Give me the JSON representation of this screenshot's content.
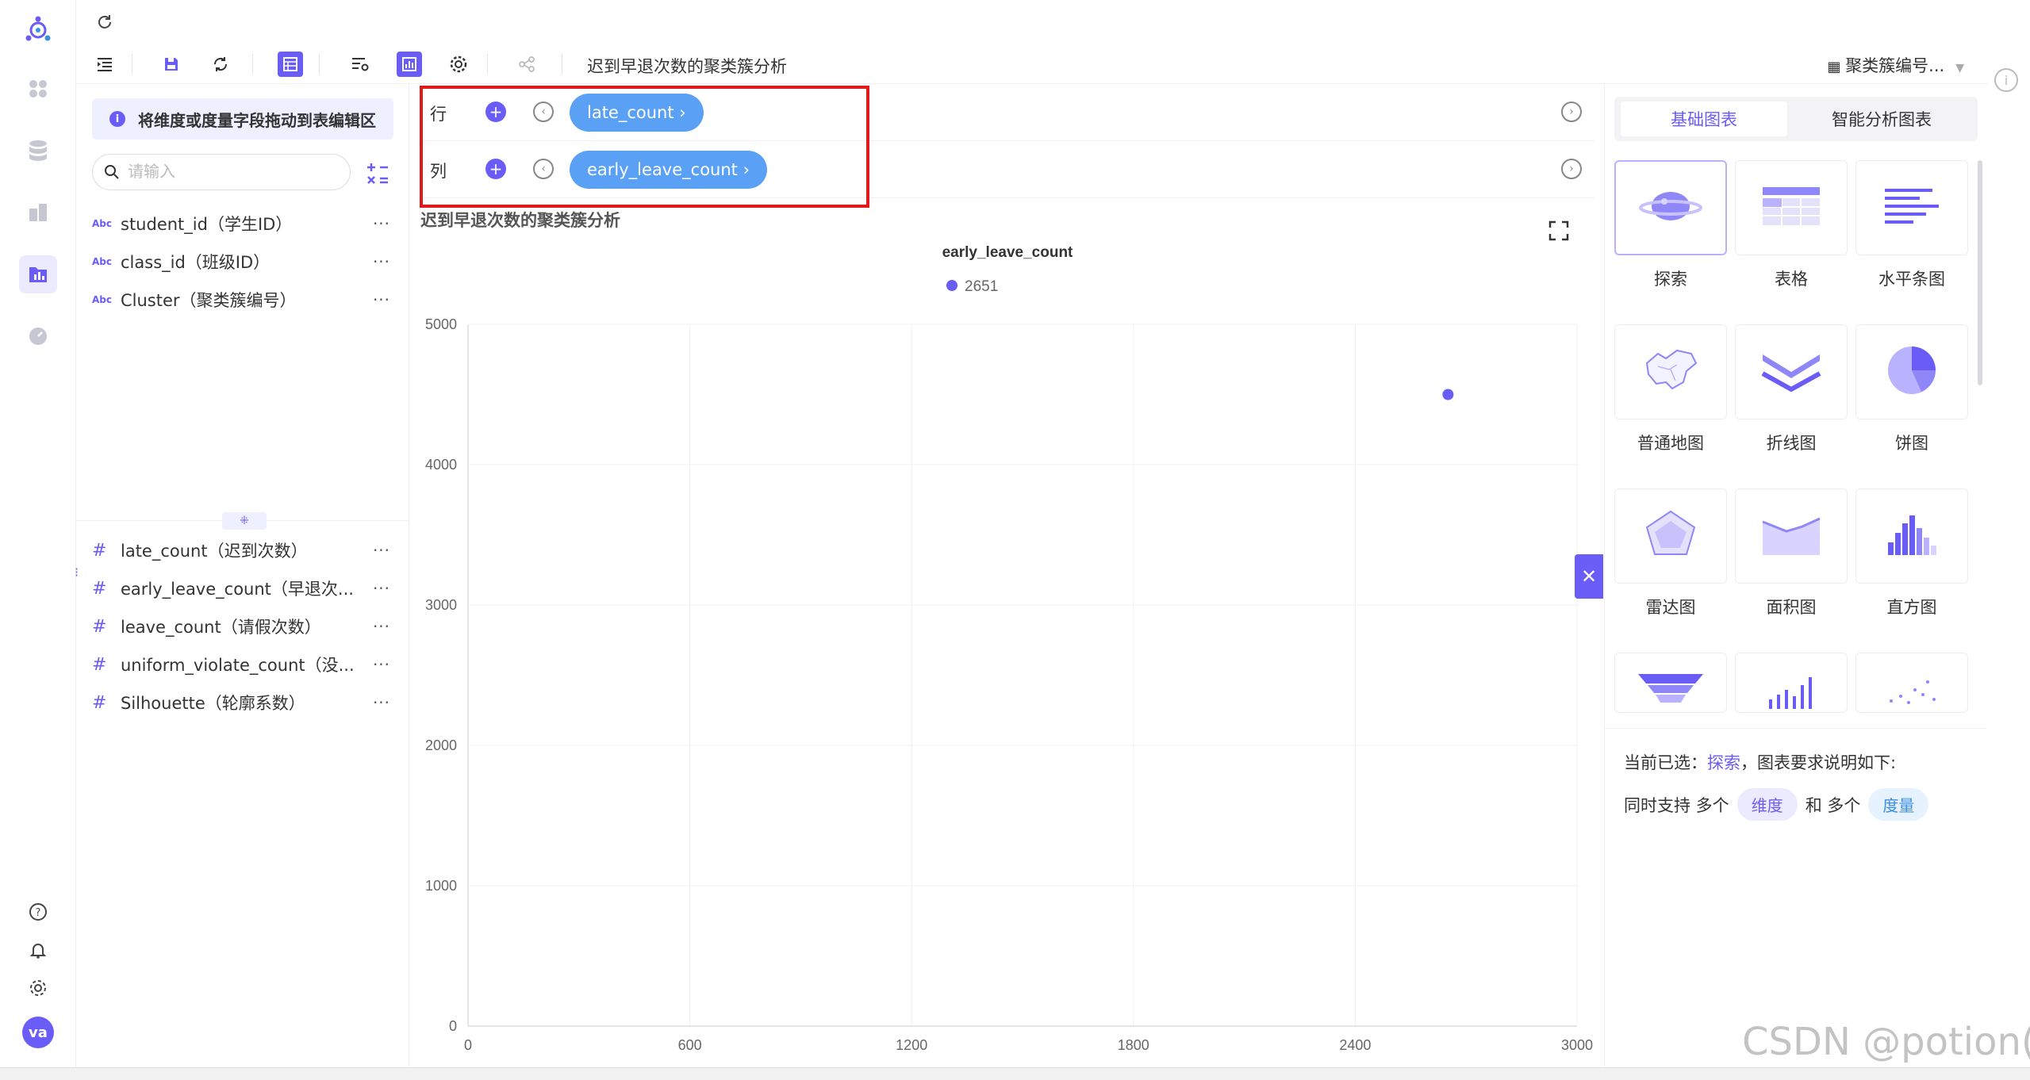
{
  "toolbar": {
    "title": "迟到早退次数的聚类簇分析",
    "dataset": "聚类簇编号..."
  },
  "field_panel": {
    "hint": "将维度或度量字段拖动到表编辑区",
    "search_placeholder": "请输入",
    "dimensions": [
      {
        "type": "Abc",
        "name": "student_id（学生ID）"
      },
      {
        "type": "Abc",
        "name": "class_id（班级ID）"
      },
      {
        "type": "Abc",
        "name": "Cluster（聚类簇编号）"
      }
    ],
    "measures": [
      {
        "type": "#",
        "name": "late_count（迟到次数）"
      },
      {
        "type": "#",
        "name": "early_leave_count（早退次..."
      },
      {
        "type": "#",
        "name": "leave_count（请假次数）"
      },
      {
        "type": "#",
        "name": "uniform_violate_count（没..."
      },
      {
        "type": "#",
        "name": "Silhouette（轮廓系数）"
      }
    ],
    "more": "···"
  },
  "shelves": {
    "row_label": "行",
    "row_pill": "late_count ›",
    "col_label": "列",
    "col_pill": "early_leave_count ›"
  },
  "chart_title": "迟到早退次数的聚类簇分析",
  "chart_data": {
    "type": "scatter",
    "title": "early_leave_count",
    "legend": [
      {
        "name": "2651",
        "color": "#6a5cf6"
      }
    ],
    "x_ticks": [
      "0",
      "600",
      "1200",
      "1800",
      "2400",
      "3000"
    ],
    "y_ticks": [
      "0",
      "1000",
      "2000",
      "3000",
      "4000",
      "5000"
    ],
    "xlim": [
      0,
      3000
    ],
    "ylim": [
      0,
      5000
    ],
    "points": [
      {
        "x": 2651,
        "y": 4500
      }
    ],
    "color": "#6a5cf6",
    "grid": true
  },
  "right_panel": {
    "tabs": [
      "基础图表",
      "智能分析图表"
    ],
    "chart_types": [
      "探索",
      "表格",
      "水平条图",
      "普通地图",
      "折线图",
      "饼图",
      "雷达图",
      "面积图",
      "直方图"
    ],
    "req_prefix": "当前已选：",
    "req_selected": "探索",
    "req_suffix": "，图表要求说明如下:",
    "req2_a": "同时支持 多个",
    "req2_dim": "维度",
    "req2_b": "和 多个",
    "req2_mea": "度量"
  },
  "user": {
    "avatar": "va"
  },
  "watermark": "CSDN @potion()",
  "colors": {
    "accent": "#6a5cf6",
    "pill": "#5aa0f5",
    "highlight": "#e01a1a"
  }
}
